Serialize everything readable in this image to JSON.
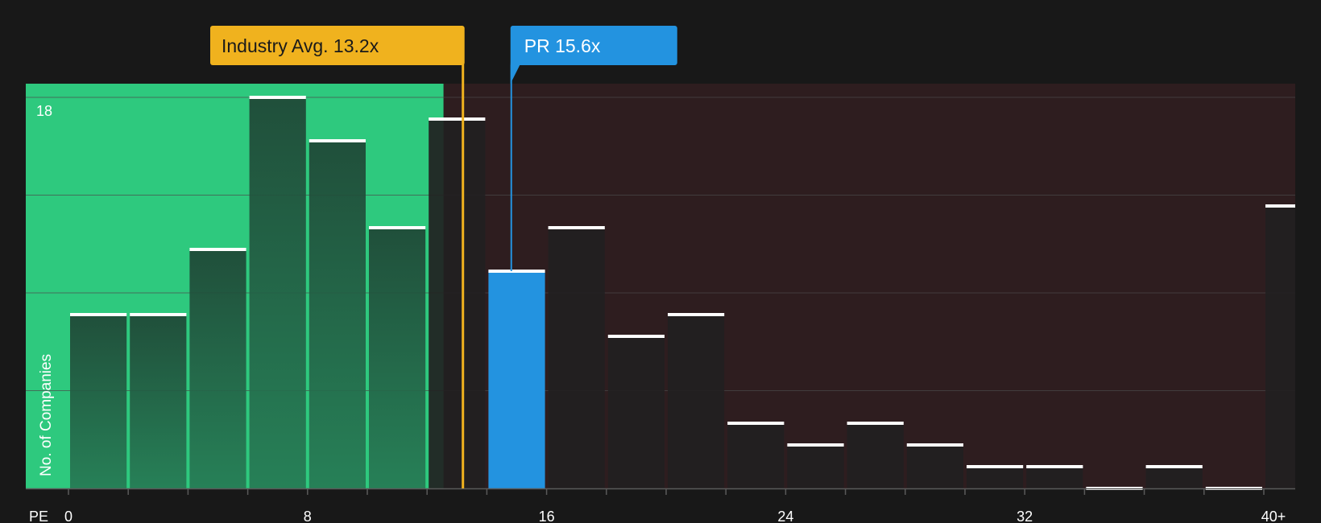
{
  "chart_data": {
    "type": "bar",
    "xlabel": "PE",
    "ylabel": "No. of Companies",
    "x_tick_labels": [
      "0",
      "8",
      "16",
      "24",
      "32",
      "40+"
    ],
    "x_tick_values": [
      0,
      8,
      16,
      24,
      32,
      40
    ],
    "y_tick_labels": [
      "18"
    ],
    "ylim": [
      0,
      18
    ],
    "grid": true,
    "bin_width": 2,
    "bins": [
      {
        "start": 0,
        "end": 2,
        "value": 8
      },
      {
        "start": 2,
        "end": 4,
        "value": 8
      },
      {
        "start": 4,
        "end": 6,
        "value": 11
      },
      {
        "start": 6,
        "end": 8,
        "value": 18
      },
      {
        "start": 8,
        "end": 10,
        "value": 16
      },
      {
        "start": 10,
        "end": 12,
        "value": 12
      },
      {
        "start": 12,
        "end": 14,
        "value": 17
      },
      {
        "start": 14,
        "end": 16,
        "value": 10
      },
      {
        "start": 16,
        "end": 18,
        "value": 12
      },
      {
        "start": 18,
        "end": 20,
        "value": 7
      },
      {
        "start": 20,
        "end": 22,
        "value": 8
      },
      {
        "start": 22,
        "end": 24,
        "value": 3
      },
      {
        "start": 24,
        "end": 26,
        "value": 2
      },
      {
        "start": 26,
        "end": 28,
        "value": 3
      },
      {
        "start": 28,
        "end": 30,
        "value": 2
      },
      {
        "start": 30,
        "end": 32,
        "value": 1
      },
      {
        "start": 32,
        "end": 34,
        "value": 1
      },
      {
        "start": 34,
        "end": 36,
        "value": 0
      },
      {
        "start": 36,
        "end": 38,
        "value": 1
      },
      {
        "start": 38,
        "end": 40,
        "value": 0
      },
      {
        "start": 40,
        "end": 42,
        "value": 13
      }
    ],
    "highlight_bin_start": 14,
    "annotations": {
      "industry": {
        "label": "Industry Avg. 13.2x",
        "value": 13.2
      },
      "company": {
        "label": "PR 15.6x",
        "value": 15.6
      }
    },
    "colors": {
      "background": "#181818",
      "fair_zone": "#2ec97e",
      "fair_bar": "#1f6b47",
      "over_zone": "#2e1d1f",
      "over_bar": "#222021",
      "highlight": "#2393e0",
      "industry": "#f0b21e",
      "cap": "#ffffff",
      "grid": "#4a4a4a",
      "tick_text": "#ffffff"
    }
  }
}
